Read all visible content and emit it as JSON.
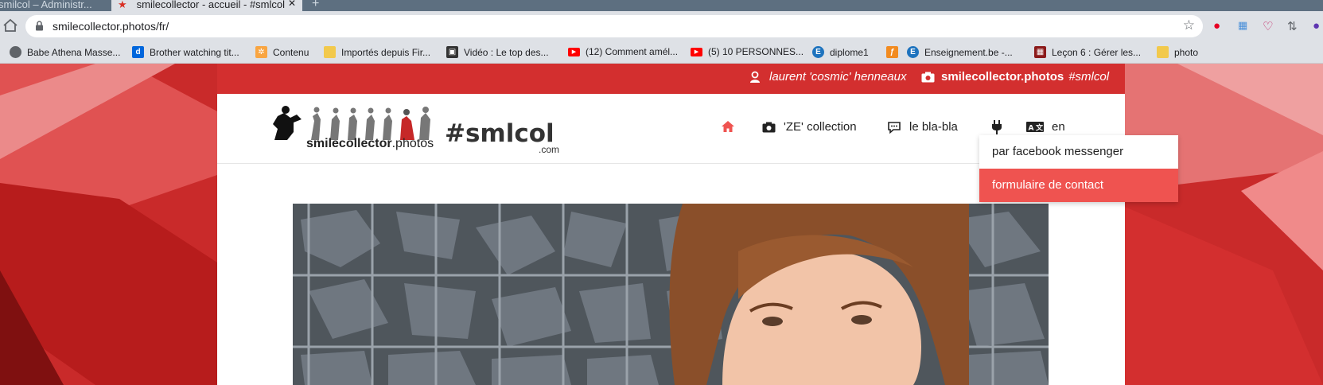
{
  "browser": {
    "tabs": [
      {
        "label": "smilcol – Administr..."
      },
      {
        "label": "smilecollector - accueil - #smlcol"
      }
    ],
    "url": "smilecollector.photos/fr/",
    "bookmarks": [
      {
        "label": "Babe Athena Masse...",
        "icon": "globe-icon",
        "color": "#5f6368"
      },
      {
        "label": "Brother watching tit...",
        "icon": "dailymotion-icon",
        "color": "#0066dc"
      },
      {
        "label": "Contenu",
        "icon": "joomla-icon",
        "color": "#f9a541"
      },
      {
        "label": "Importés depuis Fir...",
        "icon": "folder-icon",
        "color": "#f2c94c"
      },
      {
        "label": "Vidéo : Le top des...",
        "icon": "video-site-icon",
        "color": "#333333"
      },
      {
        "label": "(12) Comment amél...",
        "icon": "youtube-icon",
        "color": "#ff0000"
      },
      {
        "label": "(5) 10 PERSONNES...",
        "icon": "youtube-icon",
        "color": "#ff0000"
      },
      {
        "label": "diplome1",
        "icon": "e-icon",
        "color": "#1e73be"
      },
      {
        "label": "Enseignement.be -...",
        "icon": "enseignement-icon",
        "color": "#1e73be"
      },
      {
        "label": "Leçon 6 : Gérer les...",
        "icon": "lesson-icon",
        "color": "#8b1a1a"
      },
      {
        "label": "photo",
        "icon": "folder-icon",
        "color": "#f2c94c"
      }
    ]
  },
  "site": {
    "accent": "#d32f2f",
    "topbar": {
      "author": "laurent 'cosmic' henneaux",
      "site_name": "smilecollector.photos",
      "hashtag": "#smlcol"
    },
    "logo": {
      "brand_bold": "smilecollector",
      "brand_light": ".photos",
      "tag": "#smlcol",
      "dotcom": ".com"
    },
    "nav": {
      "collection": "'ZE' collection",
      "blabla": "le bla-bla",
      "lang": "en"
    },
    "dropdown": [
      "par facebook messenger",
      "formulaire de contact"
    ]
  }
}
